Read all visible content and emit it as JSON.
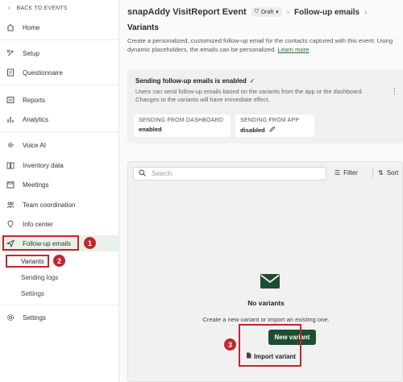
{
  "sidebar": {
    "back_label": "BACK TO EVENTS",
    "items": [
      {
        "label": "Home",
        "icon": "home-icon"
      },
      {
        "label": "Setup",
        "icon": "tools-icon"
      },
      {
        "label": "Questionnaire",
        "icon": "questionnaire-icon"
      },
      {
        "label": "Reports",
        "icon": "reports-icon"
      },
      {
        "label": "Analytics",
        "icon": "analytics-icon"
      },
      {
        "label": "Voice AI",
        "icon": "waveform-icon"
      },
      {
        "label": "Inventory data",
        "icon": "book-icon"
      },
      {
        "label": "Meetings",
        "icon": "calendar-icon"
      },
      {
        "label": "Team coordination",
        "icon": "team-icon"
      },
      {
        "label": "Info center",
        "icon": "pin-icon"
      },
      {
        "label": "Follow-up emails",
        "icon": "send-icon"
      }
    ],
    "sub_items": [
      "Variants",
      "Sending logs",
      "Settings"
    ],
    "settings_label": "Settings"
  },
  "header": {
    "event_name": "snapAddy VisitReport Event",
    "draft_label": "Draft",
    "breadcrumb": "Follow-up emails"
  },
  "page": {
    "title": "Variants",
    "description": "Create a personalized, customized follow-up email for the contacts captured with this event. Using dynamic placeholders, the emails can be personalized.",
    "learn_more": "Learn more"
  },
  "status": {
    "title": "Sending follow-up emails is enabled",
    "text": "Users can send follow-up emails based on the variants from the app or the dashboard. Changes to the variants will have immediate effect.",
    "dashboard_label": "SENDING FROM DASHBOARD",
    "dashboard_value": "enabled",
    "app_label": "SENDING FROM APP",
    "app_value": "disabled"
  },
  "variants": {
    "search_placeholder": "Search",
    "filter_label": "Filter",
    "sort_label": "Sort",
    "empty_title": "No variants",
    "empty_text": "Create a new variant or import an existing one.",
    "new_button": "New variant",
    "import_button": "Import variant"
  },
  "annotations": {
    "step1": "1",
    "step2": "2",
    "step3": "3"
  },
  "colors": {
    "accent": "#1f4d33",
    "highlight": "#c0272d",
    "active_bg": "#e9f1e8"
  }
}
